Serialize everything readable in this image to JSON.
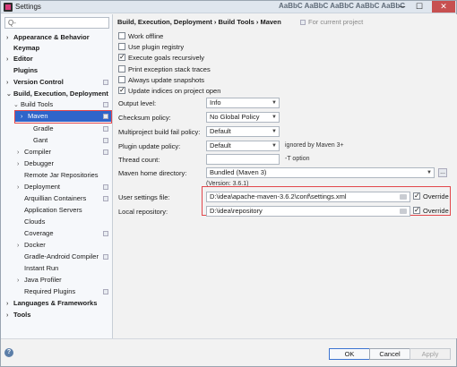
{
  "window": {
    "title": "Settings",
    "title_deco": "AaBbC AaBbC AaBbC AaBbC AaBbC",
    "close_glyph": "✕",
    "min_glyph": "─",
    "max_glyph": "☐"
  },
  "sidebar": {
    "search_placeholder": "",
    "search_glyph": "Q-",
    "items": [
      {
        "label": "Appearance & Behavior",
        "arrow": "›"
      },
      {
        "label": "Keymap",
        "arrow": ""
      },
      {
        "label": "Editor",
        "arrow": "›"
      },
      {
        "label": "Plugins",
        "arrow": ""
      },
      {
        "label": "Version Control",
        "arrow": "›"
      },
      {
        "label": "Build, Execution, Deployment",
        "arrow": "⌄"
      },
      {
        "label": "Build Tools",
        "arrow": "⌄"
      },
      {
        "label": "Maven",
        "arrow": "›"
      },
      {
        "label": "Gradle",
        "arrow": ""
      },
      {
        "label": "Gant",
        "arrow": ""
      },
      {
        "label": "Compiler",
        "arrow": "›"
      },
      {
        "label": "Debugger",
        "arrow": "›"
      },
      {
        "label": "Remote Jar Repositories",
        "arrow": ""
      },
      {
        "label": "Deployment",
        "arrow": "›"
      },
      {
        "label": "Arquillian Containers",
        "arrow": ""
      },
      {
        "label": "Application Servers",
        "arrow": ""
      },
      {
        "label": "Clouds",
        "arrow": ""
      },
      {
        "label": "Coverage",
        "arrow": ""
      },
      {
        "label": "Docker",
        "arrow": "›"
      },
      {
        "label": "Gradle-Android Compiler",
        "arrow": ""
      },
      {
        "label": "Instant Run",
        "arrow": ""
      },
      {
        "label": "Java Profiler",
        "arrow": "›"
      },
      {
        "label": "Required Plugins",
        "arrow": ""
      },
      {
        "label": "Languages & Frameworks",
        "arrow": "›"
      },
      {
        "label": "Tools",
        "arrow": "›"
      }
    ]
  },
  "main": {
    "breadcrumb": "Build, Execution, Deployment  ›  Build Tools  ›  Maven",
    "for_current_project": "For current project",
    "checkboxes": [
      {
        "label": "Work offline",
        "checked": false
      },
      {
        "label": "Use plugin registry",
        "checked": false
      },
      {
        "label": "Execute goals recursively",
        "checked": true
      },
      {
        "label": "Print exception stack traces",
        "checked": false
      },
      {
        "label": "Always update snapshots",
        "checked": false
      },
      {
        "label": "Update indices on project open",
        "checked": true
      }
    ],
    "output_level_label": "Output level:",
    "output_level_value": "Info",
    "checksum_label": "Checksum policy:",
    "checksum_value": "No Global Policy",
    "fail_policy_label": "Multiproject build fail policy:",
    "fail_policy_value": "Default",
    "plugin_update_label": "Plugin update policy:",
    "plugin_update_value": "Default",
    "plugin_update_hint": "ignored by Maven 3+",
    "thread_count_label": "Thread count:",
    "thread_count_value": "",
    "thread_count_hint": "-T option",
    "maven_home_label": "Maven home directory:",
    "maven_home_value": "Bundled (Maven 3)",
    "maven_home_browse": "...",
    "version_text": "(Version: 3.6.1)",
    "user_settings_label": "User settings file:",
    "user_settings_value": "D:\\idea\\apache-maven-3.6.2\\conf\\settings.xml",
    "user_settings_override": "Override",
    "local_repo_label": "Local repository:",
    "local_repo_value": "D:\\idea\\repository",
    "local_repo_override": "Override"
  },
  "footer": {
    "help": "?",
    "ok": "OK",
    "cancel": "Cancel",
    "apply": "Apply"
  },
  "colors": {
    "selection": "#2f65ca",
    "highlight_box": "#e2474b"
  }
}
